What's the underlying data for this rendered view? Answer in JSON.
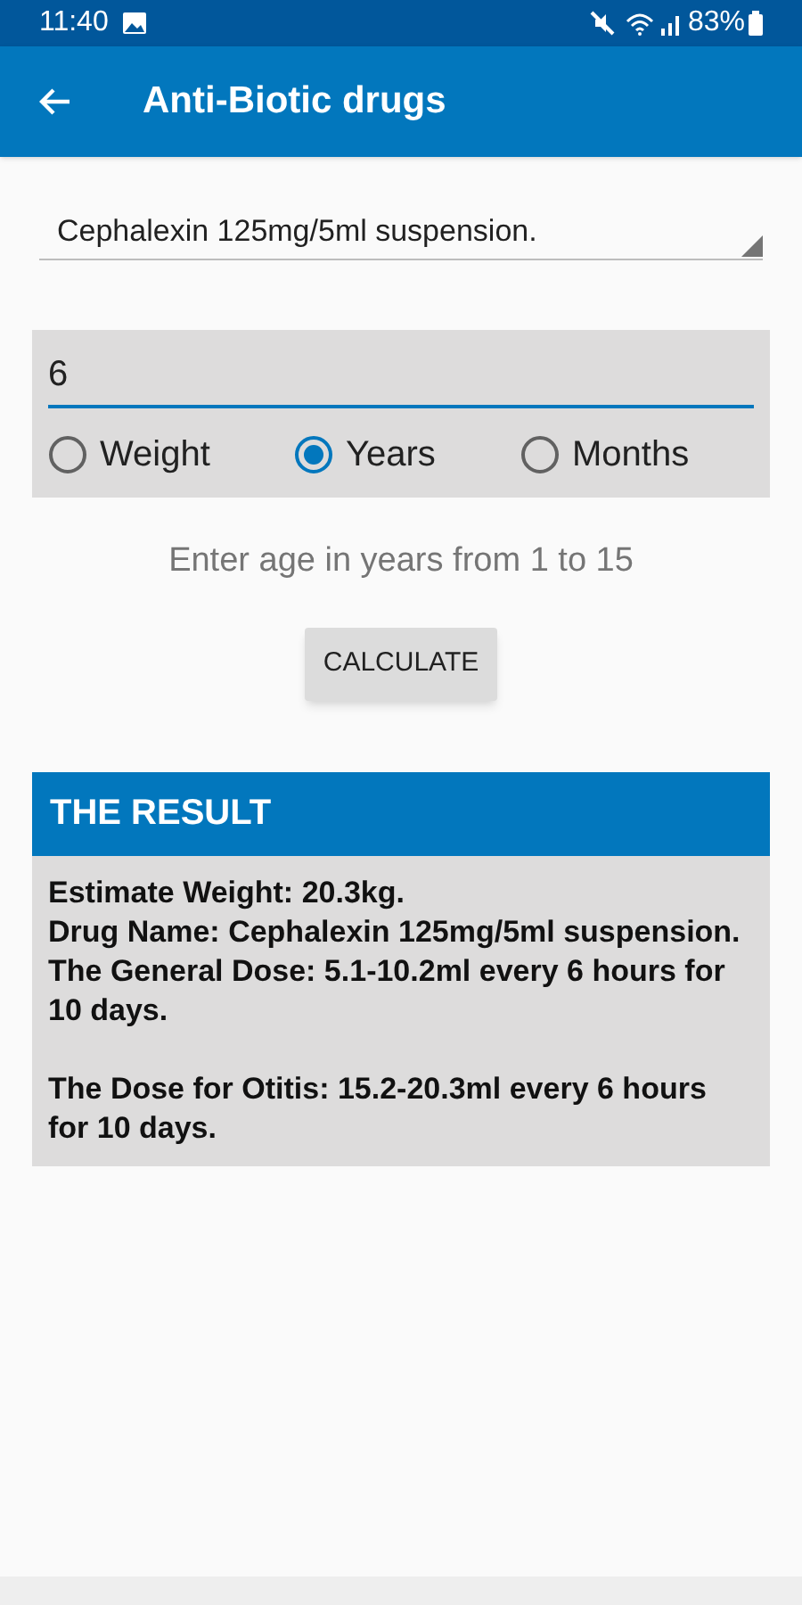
{
  "status_bar": {
    "time": "11:40",
    "battery": "83%"
  },
  "app_bar": {
    "title": "Anti-Biotic drugs"
  },
  "drug_dropdown": {
    "value": "Cephalexin 125mg/5ml suspension."
  },
  "input": {
    "value": "6"
  },
  "units": [
    {
      "label": "Weight",
      "selected": false
    },
    {
      "label": "Years",
      "selected": true
    },
    {
      "label": "Months",
      "selected": false
    }
  ],
  "hint": "Enter age in years from 1 to 15",
  "calculate_button": "CALCULATE",
  "result": {
    "title": "THE RESULT",
    "paragraphs": [
      [
        "Estimate Weight: 20.3kg.",
        "Drug Name: Cephalexin 125mg/5ml suspension.",
        "The General Dose: 5.1-10.2ml every 6 hours for 10 days."
      ],
      [
        "The Dose for Otitis: 15.2-20.3ml every 6 hours for 10 days."
      ]
    ]
  }
}
